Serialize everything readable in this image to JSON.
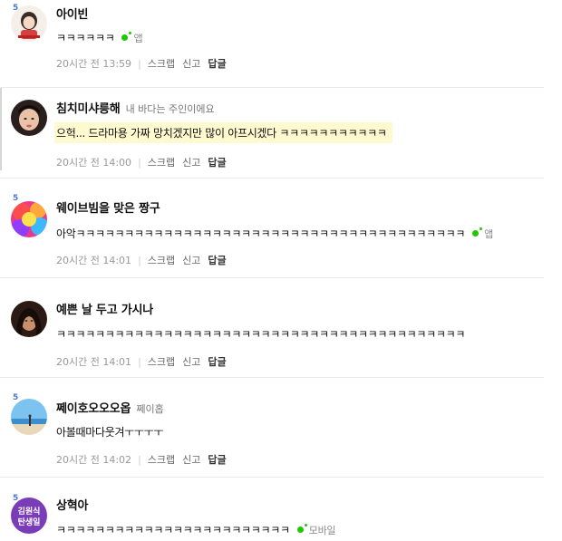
{
  "comments": [
    {
      "grade": "5",
      "nick": "아이빈",
      "tag": "",
      "text": "ㅋㅋㅋㅋㅋㅋ",
      "device": "앱",
      "time": "20시간 전 13:59"
    },
    {
      "grade": "",
      "nick": "침치미샤릉해",
      "tag": "내 바다는 주인이에요",
      "text": "으헉... 드라마용 가짜 망치겠지만 많이 아프시겠다 ㅋㅋㅋㅋㅋㅋㅋㅋㅋㅋㅋ",
      "device": "",
      "time": "20시간 전 14:00"
    },
    {
      "grade": "5",
      "nick": "웨이브빔을 맞은 짱구",
      "tag": "",
      "text": "아악ㅋㅋㅋㅋㅋㅋㅋㅋㅋㅋㅋㅋㅋㅋㅋㅋㅋㅋㅋㅋㅋㅋㅋㅋㅋㅋㅋㅋㅋㅋㅋㅋㅋㅋㅋㅋㅋㅋㅋㅋ",
      "device": "앱",
      "time": "20시간 전 14:01"
    },
    {
      "grade": "",
      "nick": "예쁜 날 두고 가시나",
      "tag": "",
      "text": "ㅋㅋㅋㅋㅋㅋㅋㅋㅋㅋㅋㅋㅋㅋㅋㅋㅋㅋㅋㅋㅋㅋㅋㅋㅋㅋㅋㅋㅋㅋㅋㅋㅋㅋㅋㅋㅋㅋㅋㅋㅋㅋ",
      "device": "",
      "time": "20시간 전 14:01"
    },
    {
      "grade": "5",
      "nick": "쩨이호오오오옵",
      "tag": "쩨이홉",
      "text": "아볼때마다웃겨ㅜㅜㅜㅜ",
      "device": "",
      "time": "20시간 전 14:02"
    },
    {
      "grade": "5",
      "nick": "상혁아",
      "tag": "",
      "text": "ㅋㅋㅋㅋㅋㅋㅋㅋㅋㅋㅋㅋㅋㅋㅋㅋㅋㅋㅋㅋㅋㅋㅋㅋ",
      "device": "모바일",
      "time": ""
    }
  ],
  "actions": {
    "scrap": "스크랩",
    "report": "신고",
    "reply": "답글"
  },
  "avatar4_text": {
    "line1": "김원식",
    "line2": "탄생일"
  },
  "colors": {
    "app_dot": "#1ec800",
    "grade": "#4a78d8",
    "highlight": "#fff9d0"
  }
}
